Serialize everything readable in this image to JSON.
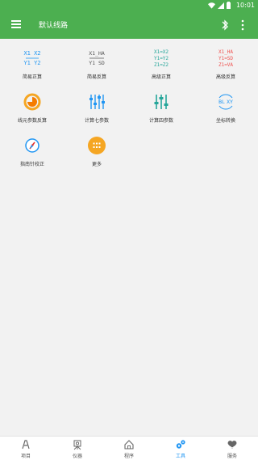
{
  "status": {
    "time": "10:01"
  },
  "appbar": {
    "title": "默认线路"
  },
  "tools": [
    {
      "label": "简易正算",
      "icon": "simple-forward-calc-icon",
      "glyph": [
        "X1 X2",
        "Y1 Y2"
      ],
      "color": "#2196f3"
    },
    {
      "label": "简易反算",
      "icon": "simple-inverse-calc-icon",
      "glyph": [
        "X1_HA",
        "Y1 SD"
      ],
      "color": "#555555"
    },
    {
      "label": "高级正算",
      "icon": "advanced-forward-calc-icon",
      "glyph": [
        "X1=X2",
        "Y1=Y2",
        "Z1=Z2"
      ],
      "color": "#26a69a"
    },
    {
      "label": "高级反算",
      "icon": "advanced-inverse-calc-icon",
      "glyph": [
        "X1_HA",
        "Y1=SD",
        "Z1=VA"
      ],
      "color": "#ef5350"
    },
    {
      "label": "线元参数反算",
      "icon": "line-element-param-icon",
      "color": "#f5a623"
    },
    {
      "label": "计算七参数",
      "icon": "seven-param-icon",
      "color": "#2196f3"
    },
    {
      "label": "计算四参数",
      "icon": "four-param-icon",
      "color": "#26a69a"
    },
    {
      "label": "坐标转换",
      "icon": "coordinate-convert-icon",
      "glyph": [
        "BL",
        "XY"
      ],
      "color": "#2196f3"
    },
    {
      "label": "指南针校正",
      "icon": "compass-calibrate-icon",
      "color": "#2196f3"
    },
    {
      "label": "更多",
      "icon": "more-apps-icon",
      "color": "#f5a623"
    }
  ],
  "tabs": [
    {
      "label": "项目",
      "icon": "project-icon",
      "active": false
    },
    {
      "label": "仪器",
      "icon": "instrument-icon",
      "active": false
    },
    {
      "label": "程序",
      "icon": "program-home-icon",
      "active": false
    },
    {
      "label": "工具",
      "icon": "tools-gear-icon",
      "active": true
    },
    {
      "label": "服务",
      "icon": "service-icon",
      "active": false
    }
  ]
}
